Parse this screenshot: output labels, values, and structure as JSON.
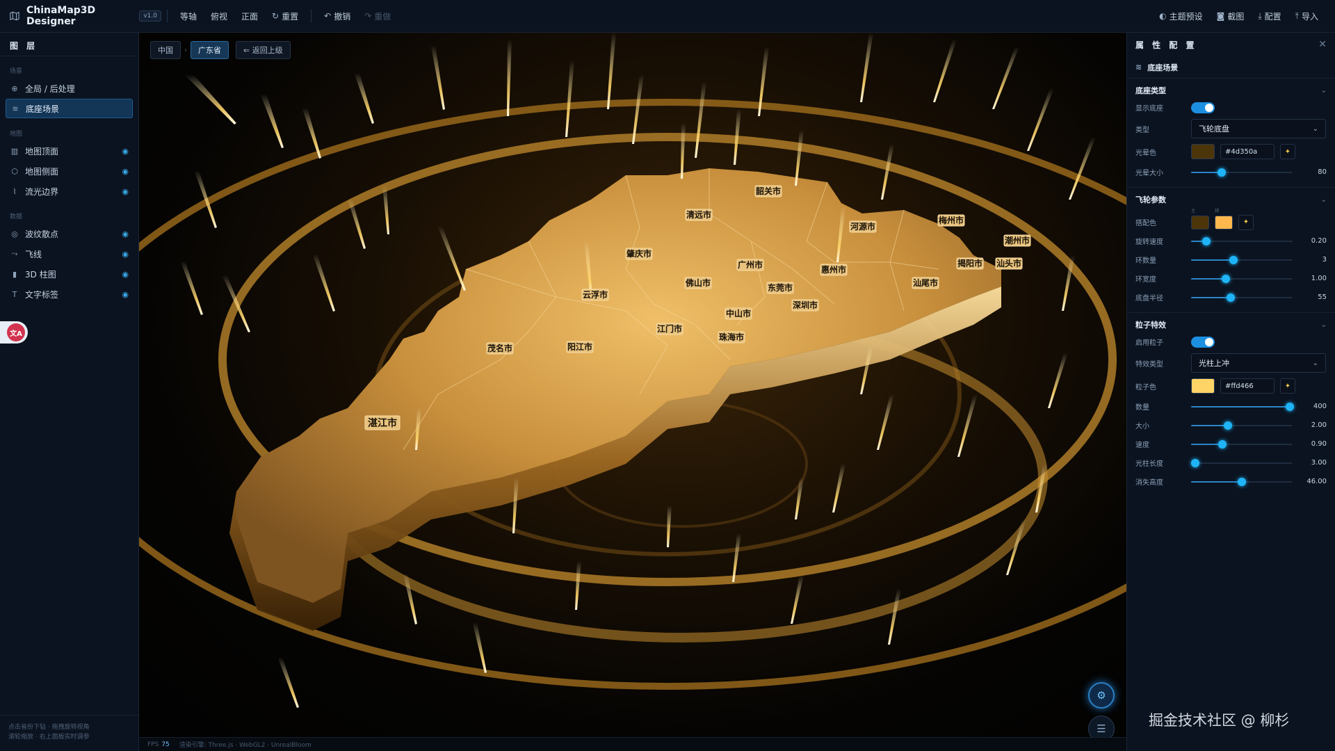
{
  "app": {
    "name": "ChinaMap3D Designer",
    "version": "v1.0"
  },
  "toolbar": {
    "view_buttons": [
      "等轴",
      "俯视",
      "正面"
    ],
    "reset": "重置",
    "undo": "撤销",
    "redo": "重做",
    "right": [
      {
        "label": "主题预设",
        "icon": "palette-icon"
      },
      {
        "label": "截图",
        "icon": "camera-icon"
      },
      {
        "label": "配置",
        "icon": "download-icon"
      },
      {
        "label": "导入",
        "icon": "upload-icon"
      }
    ]
  },
  "layers": {
    "title": "图 层",
    "groups": [
      {
        "name": "场景",
        "items": [
          {
            "label": "全局 / 后处理",
            "icon": "globe-icon",
            "eye": false,
            "active": false
          },
          {
            "label": "底座场景",
            "icon": "layers-icon",
            "eye": false,
            "active": true
          }
        ]
      },
      {
        "name": "地图",
        "items": [
          {
            "label": "地图顶面",
            "icon": "map-icon",
            "eye": true,
            "active": false
          },
          {
            "label": "地图侧面",
            "icon": "cube-icon",
            "eye": true,
            "active": false
          },
          {
            "label": "流光边界",
            "icon": "route-icon",
            "eye": true,
            "active": false
          }
        ]
      },
      {
        "name": "数据",
        "items": [
          {
            "label": "波纹散点",
            "icon": "pin-icon",
            "eye": true,
            "active": false
          },
          {
            "label": "飞线",
            "icon": "flyline-icon",
            "eye": true,
            "active": false
          },
          {
            "label": "3D 柱图",
            "icon": "bar-chart-icon",
            "eye": true,
            "active": false
          },
          {
            "label": "文字标签",
            "icon": "text-icon",
            "eye": true,
            "active": false
          }
        ]
      }
    ],
    "footer": [
      "点击省份下钻 · 拖拽旋转视角",
      "滚轮缩放 · 右上面板实时调参"
    ]
  },
  "breadcrumb": {
    "items": [
      "中国",
      "广东省"
    ],
    "back": "返回上级"
  },
  "map": {
    "cities": [
      "韶关市",
      "清远市",
      "梅州市",
      "河源市",
      "潮州市",
      "肇庆市",
      "广州市",
      "惠州市",
      "揭阳市",
      "汕头市",
      "佛山市",
      "东莞市",
      "汕尾市",
      "云浮市",
      "中山市",
      "深圳市",
      "江门市",
      "珠海市",
      "茂名市",
      "阳江市",
      "湛江市"
    ]
  },
  "status": {
    "fps_label": "FPS",
    "fps": "75",
    "engine": "渲染引擎: Three.js · WebGL2 · UnrealBloom"
  },
  "props": {
    "title": "属 性 配 置",
    "scene": "底座场景",
    "sections": {
      "base": {
        "title": "底座类型",
        "show_label": "显示底座",
        "type_label": "类型",
        "type_value": "飞轮底盘",
        "halo_color_label": "光晕色",
        "halo_color": "#4d350a",
        "halo_size_label": "光晕大小",
        "halo_size": "80",
        "halo_size_frac": 0.3
      },
      "wheel": {
        "title": "飞轮参数",
        "color_label": "搭配色",
        "pair_tags": [
          "主",
          "辅"
        ],
        "colors": [
          "#4d350a",
          "#ffb84d"
        ],
        "sliders": [
          {
            "label": "旋转速度",
            "value": "0.20",
            "frac": 0.15
          },
          {
            "label": "环数量",
            "value": "3",
            "frac": 0.42
          },
          {
            "label": "环宽度",
            "value": "1.00",
            "frac": 0.34
          },
          {
            "label": "底盘半径",
            "value": "55",
            "frac": 0.39
          }
        ]
      },
      "particle": {
        "title": "粒子特效",
        "enable_label": "启用粒子",
        "type_label": "特效类型",
        "type_value": "光柱上冲",
        "color_label": "粒子色",
        "color": "#ffd466",
        "sliders": [
          {
            "label": "数量",
            "value": "400",
            "frac": 0.97
          },
          {
            "label": "大小",
            "value": "2.00",
            "frac": 0.36
          },
          {
            "label": "速度",
            "value": "0.90",
            "frac": 0.31
          },
          {
            "label": "光柱长度",
            "value": "3.00",
            "frac": 0.04
          },
          {
            "label": "消失高度",
            "value": "46.00",
            "frac": 0.5
          }
        ]
      }
    }
  },
  "watermark": "掘金技术社区 @ 柳杉"
}
